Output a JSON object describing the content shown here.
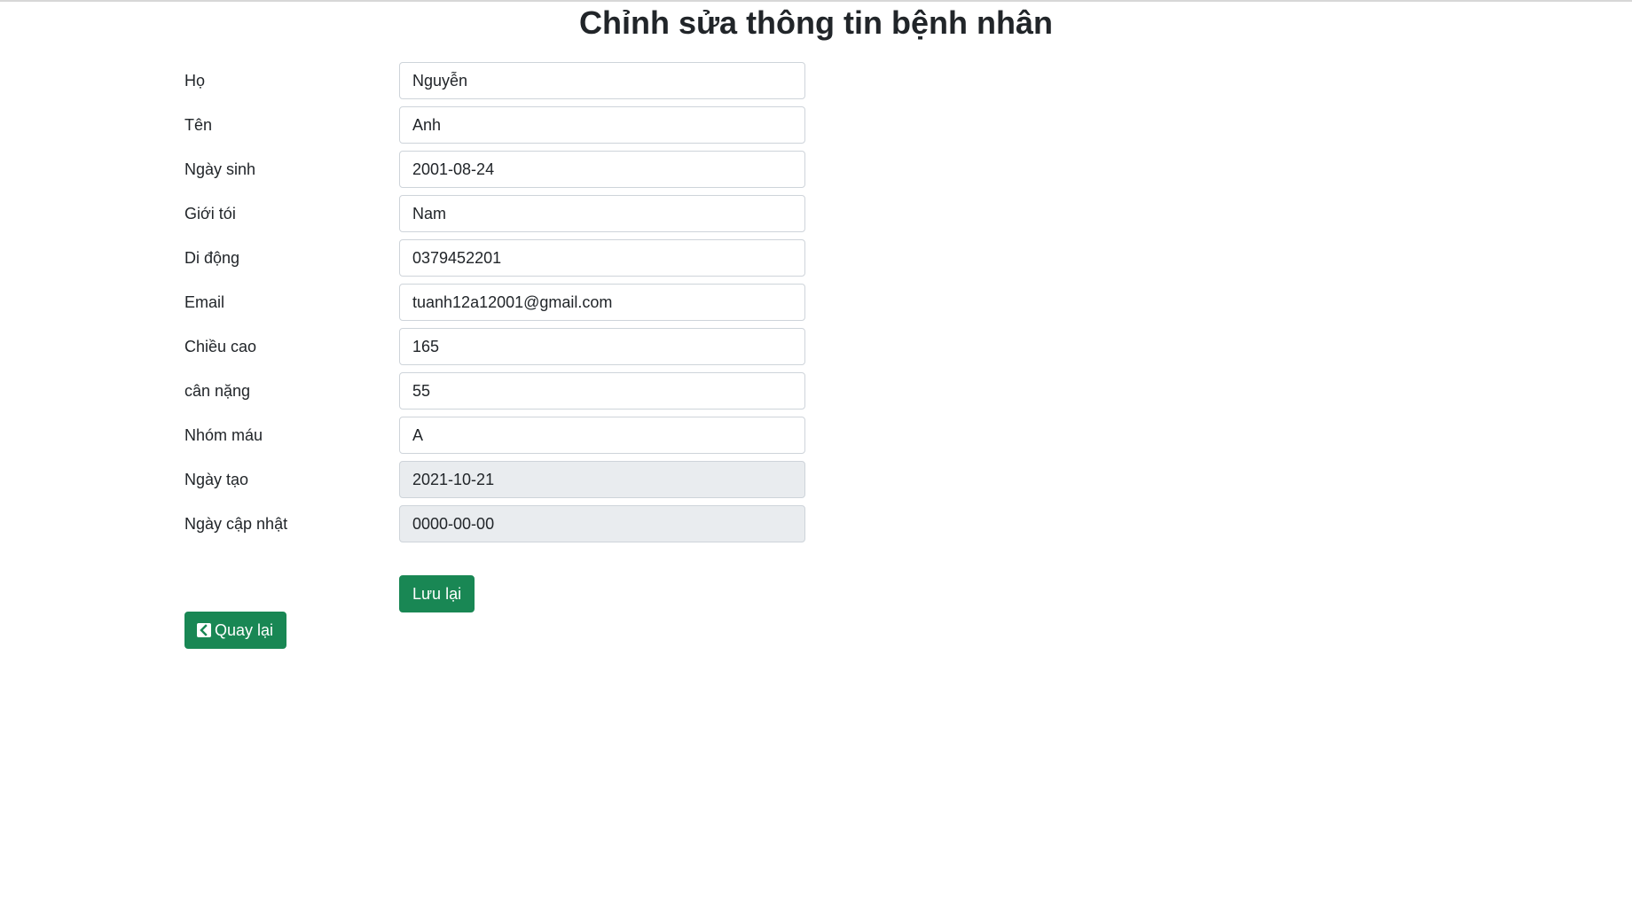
{
  "page": {
    "title": "Chỉnh sửa thông tin bệnh nhân"
  },
  "form": {
    "fields": [
      {
        "label": "Họ",
        "value": "Nguyễn",
        "readonly": false
      },
      {
        "label": "Tên",
        "value": "Anh",
        "readonly": false
      },
      {
        "label": "Ngày sinh",
        "value": "2001-08-24",
        "readonly": false
      },
      {
        "label": "Giới tói",
        "value": "Nam",
        "readonly": false
      },
      {
        "label": "Di động",
        "value": "0379452201",
        "readonly": false
      },
      {
        "label": "Email",
        "value": "tuanh12a12001@gmail.com",
        "readonly": false
      },
      {
        "label": "Chiều cao",
        "value": "165",
        "readonly": false
      },
      {
        "label": "cân nặng",
        "value": "55",
        "readonly": false
      },
      {
        "label": "Nhóm máu",
        "value": "A",
        "readonly": false
      },
      {
        "label": "Ngày tạo",
        "value": "2021-10-21",
        "readonly": true
      },
      {
        "label": "Ngày cập nhật",
        "value": "0000-00-00",
        "readonly": true
      }
    ],
    "save_label": "Lưu lại"
  },
  "nav": {
    "back_label": "Quay lại",
    "back_icon": "chevron-left-icon"
  },
  "colors": {
    "button": "#198754",
    "readonly_bg": "#e9ecef",
    "input_border": "#ced4da"
  }
}
